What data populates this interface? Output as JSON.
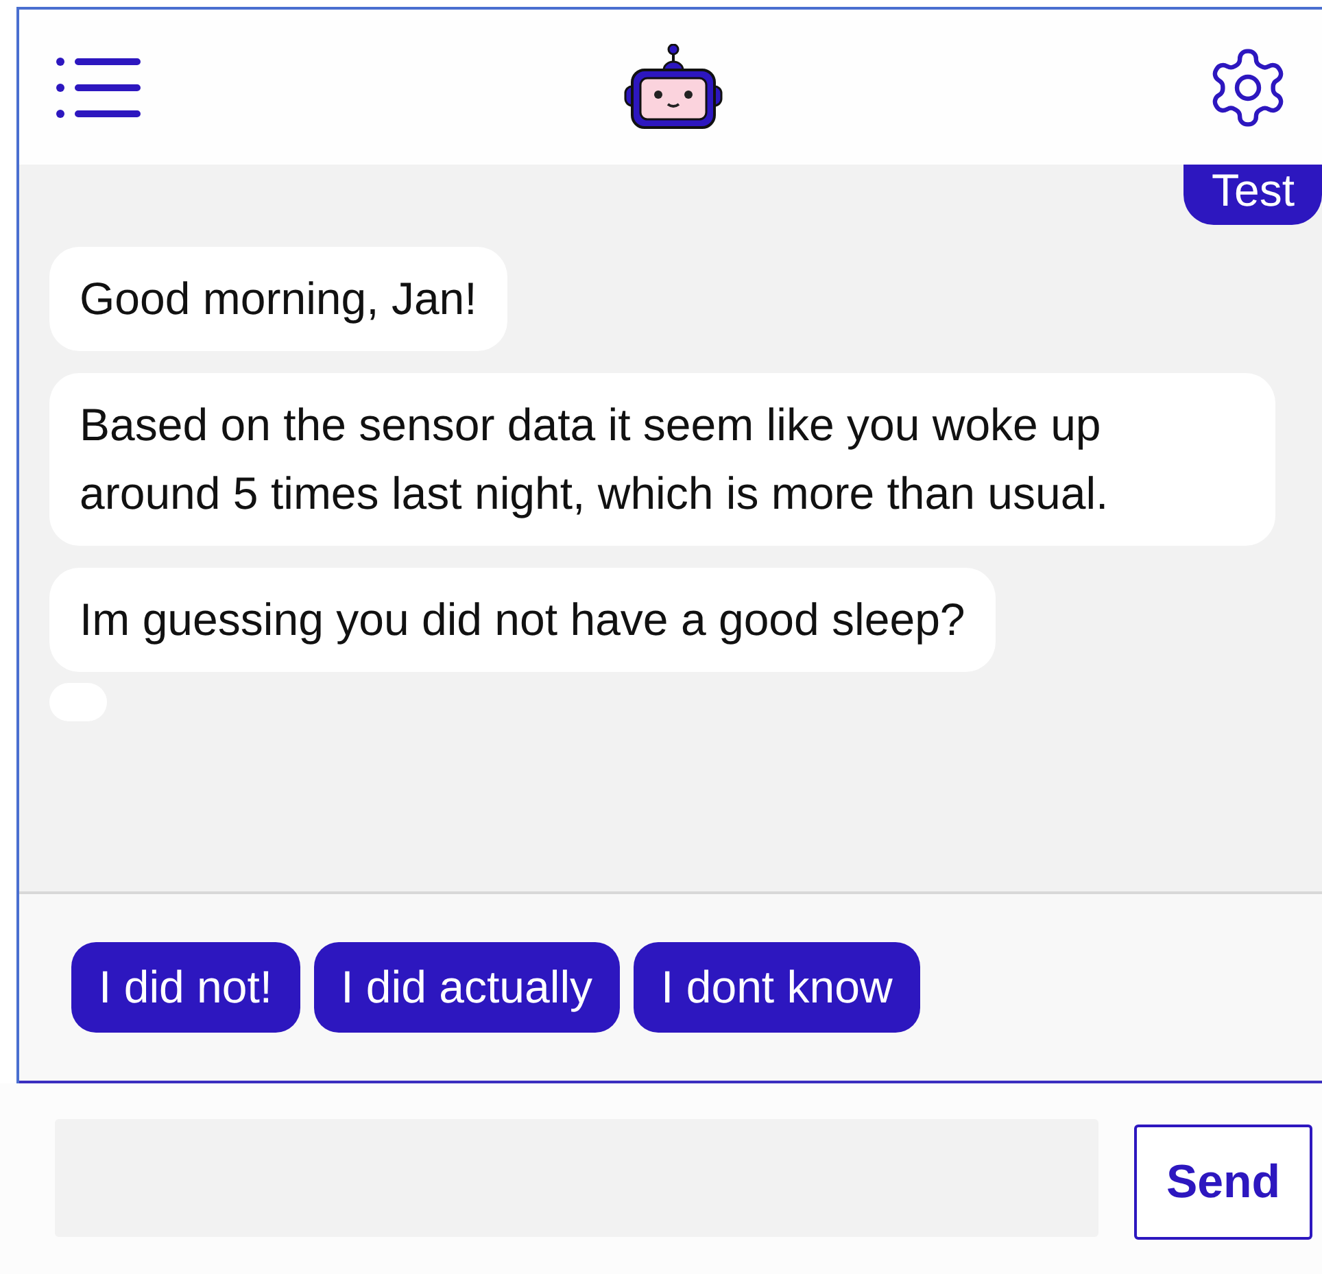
{
  "messages": [
    {
      "kind": "user",
      "text": "Test"
    },
    {
      "kind": "bot",
      "text": "Good morning, Jan!"
    },
    {
      "kind": "bot",
      "text": "Based on the sensor data it seem like you woke up around 5 times last night, which is more than usual."
    },
    {
      "kind": "bot",
      "text": "Im guessing you did not have a good sleep?"
    },
    {
      "kind": "empty"
    }
  ],
  "quick_replies": [
    "I did not!",
    "I did actually",
    "I dont know"
  ],
  "composer": {
    "send_label": "Send"
  }
}
